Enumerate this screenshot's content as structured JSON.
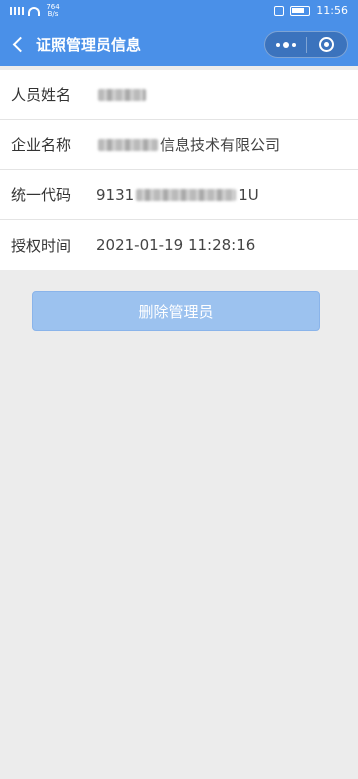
{
  "status_bar": {
    "speed_value": "764",
    "speed_unit": "B/s",
    "time": "11:56"
  },
  "nav": {
    "title": "证照管理员信息"
  },
  "rows": [
    {
      "label": "人员姓名",
      "value_prefix": "",
      "value_suffix": ""
    },
    {
      "label": "企业名称",
      "value_prefix": "",
      "value_suffix": "信息技术有限公司"
    },
    {
      "label": "统一代码",
      "value_prefix": "9131",
      "value_suffix": "1U"
    },
    {
      "label": "授权时间",
      "value_prefix": "2021-01-19 11:28:16",
      "value_suffix": ""
    }
  ],
  "delete_button": {
    "label": "删除管理员"
  },
  "colors": {
    "header": "#4a90e8",
    "page_bg": "#ececec",
    "button_disabled": "#9cc2ef"
  },
  "icons": [
    "signal-icon",
    "wifi-icon",
    "vibrate-icon",
    "battery-icon",
    "back-chevron-icon",
    "more-dots-icon",
    "target-icon"
  ]
}
